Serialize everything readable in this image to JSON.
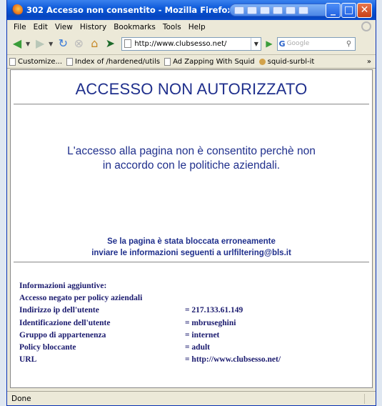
{
  "window": {
    "title": "302 Accesso non consentito - Mozilla Firefox"
  },
  "menu": [
    "File",
    "Edit",
    "View",
    "History",
    "Bookmarks",
    "Tools",
    "Help"
  ],
  "navbar": {
    "url": "http://www.clubsesso.net/",
    "search_placeholder": "Google"
  },
  "bookmarks": [
    "Customize...",
    "Index of /hardened/utils",
    "Ad Zapping With Squid",
    "squid-surbl-it"
  ],
  "page": {
    "heading": "ACCESSO NON AUTORIZZATO",
    "main_line1": "L'accesso alla pagina non è consentito perchè non",
    "main_line2": "in accordo con le politiche aziendali.",
    "err_line1": "Se la pagina è stata bloccata erroneamente",
    "err_line2": "inviare le informazioni seguenti a urlfiltering@bls.it",
    "info_title": "Informazioni aggiuntive:",
    "info_reason": "Accesso negato per policy aziendali",
    "details": [
      {
        "label": "Indirizzo ip dell'utente",
        "value": "= 217.133.61.149"
      },
      {
        "label": "Identificazione dell'utente",
        "value": "= mbruseghini"
      },
      {
        "label": "Gruppo di appartenenza",
        "value": "= internet"
      },
      {
        "label": "Policy bloccante",
        "value": "= adult"
      },
      {
        "label": "URL",
        "value": "= http://www.clubsesso.net/"
      }
    ]
  },
  "status": "Done"
}
